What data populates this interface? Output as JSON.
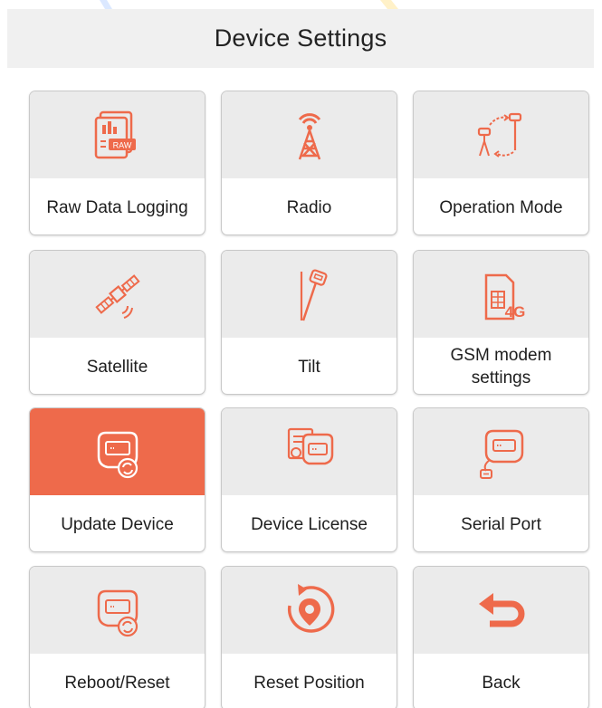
{
  "header": {
    "title": "Device Settings"
  },
  "colors": {
    "accent": "#ee6a4b",
    "icon_background": "#ebebeb",
    "header_background": "#f0f0f0",
    "text": "#1e1e1e"
  },
  "tiles": [
    {
      "label": "Raw Data Logging",
      "icon": "raw-data-icon",
      "active": false
    },
    {
      "label": "Radio",
      "icon": "radio-tower-icon",
      "active": false
    },
    {
      "label": "Operation Mode",
      "icon": "operation-mode-icon",
      "active": false
    },
    {
      "label": "Satellite",
      "icon": "satellite-icon",
      "active": false
    },
    {
      "label": "Tilt",
      "icon": "tilt-pole-icon",
      "active": false
    },
    {
      "label": "GSM modem settings",
      "icon": "sim-4g-icon",
      "active": false
    },
    {
      "label": "Update Device",
      "icon": "device-update-icon",
      "active": true
    },
    {
      "label": "Device License",
      "icon": "device-license-icon",
      "active": false
    },
    {
      "label": "Serial Port",
      "icon": "serial-port-icon",
      "active": false
    },
    {
      "label": "Reboot/Reset",
      "icon": "device-reboot-icon",
      "active": false
    },
    {
      "label": "Reset Position",
      "icon": "reset-position-icon",
      "active": false
    },
    {
      "label": "Back",
      "icon": "back-arrow-icon",
      "active": false
    }
  ],
  "raw_icon_text": "RAW",
  "sim_icon_text": "4G"
}
